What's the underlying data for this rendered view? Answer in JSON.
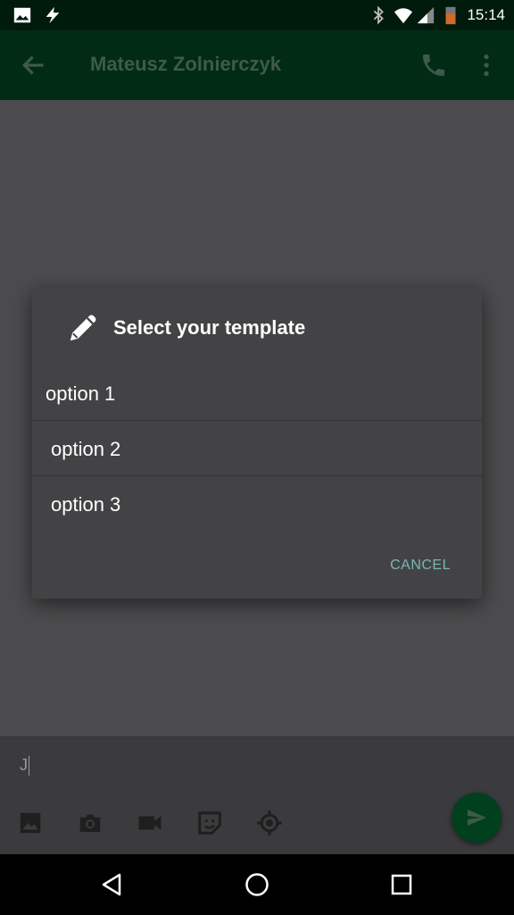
{
  "status_bar": {
    "time": "15:14",
    "icons": [
      "image-icon",
      "flash-icon",
      "bluetooth-icon",
      "wifi-icon",
      "signal-icon",
      "battery-icon"
    ]
  },
  "toolbar": {
    "title": "Mateusz Zolnierczyk",
    "icons": [
      "back-arrow-icon",
      "phone-icon",
      "more-vert-icon"
    ]
  },
  "composer": {
    "typed_text": "J",
    "icons": [
      "image-icon",
      "camera-icon",
      "video-icon",
      "sticker-icon",
      "location-icon",
      "send-icon"
    ]
  },
  "dialog": {
    "title": "Select your template",
    "options": [
      "option 1",
      "option 2",
      "option 3"
    ],
    "cancel_label": "CANCEL"
  },
  "colors": {
    "toolbar_bg": "#012b15",
    "fab_bg": "#00401f",
    "dialog_bg": "#434345",
    "accent": "#7ab8b2"
  }
}
